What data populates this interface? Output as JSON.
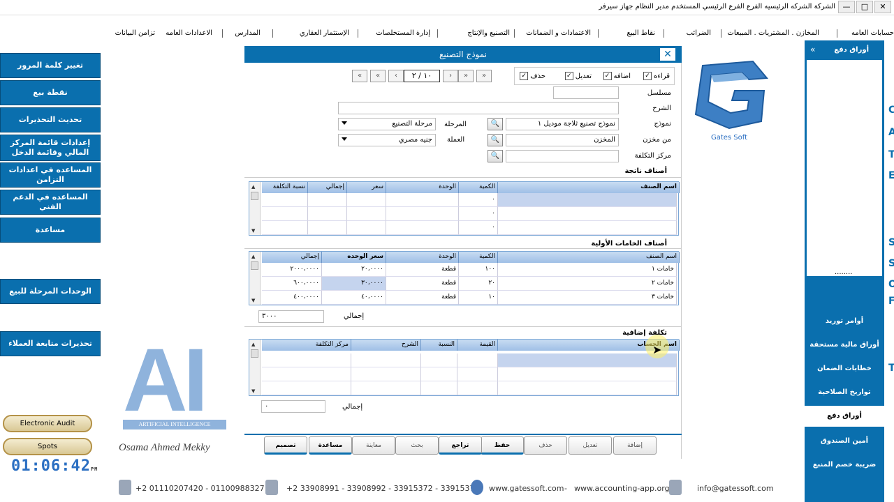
{
  "window": {
    "title": "الشركة الشركه الرئيسيه   الفرع الفرع الرئيسي   المستخدم مدير النظام   جهاز سيرفر",
    "buttons": [
      "—",
      "□",
      "✕"
    ]
  },
  "menu": [
    "حسابات العامه",
    "المخازن . المشتريات . المبيعات",
    "الضرائب",
    "نقاط البيع",
    "الاعتمادات و الضمانات",
    "التصنيع والإنتاج",
    "إدارة المستخلصات",
    "الإستثمار العقاري",
    "المدارس",
    "الاعدادات العامه",
    "تزامن البيانات"
  ],
  "left_buttons": [
    "تغيير كلمة المرور",
    "نقطة بيع",
    "تحديث التحذيرات",
    "إعدادات قائمة المركز المالي وقائمة الدخل",
    "المساعده في اعدادات التزامن",
    "المساعده في الدعم الفني",
    "مساعدة",
    "الوحدات المرحلة للبيع",
    "تحذيرات متابعة العملاء"
  ],
  "yellow_buttons": [
    "Electronic Audit",
    "Spots"
  ],
  "clock": {
    "time": "01:06:42",
    "suffix": "PM"
  },
  "right_panel": {
    "header": "أوراق دفع",
    "collapse_icon": "«",
    "dots": "........",
    "items": [
      "أوامر توريد",
      "أوراق مالية مستحقة",
      "خطابات الضمان",
      "تواريخ الصلاحية",
      "أوراق دفع",
      "أمين الصندوق",
      "ضريبة خصم المنبع"
    ],
    "active_index": 4
  },
  "right_strip_letters": [
    "C",
    "A",
    "T",
    "E",
    "S",
    "S",
    "O",
    "F",
    "T"
  ],
  "dialog": {
    "title": "نموذج التصنيع",
    "pager": "١٠ / ٢",
    "nav": [
      "«",
      "‹",
      "›",
      "»"
    ],
    "permissions": [
      {
        "label": "قراءه",
        "checked": true
      },
      {
        "label": "اضافه",
        "checked": true
      },
      {
        "label": "تعديل",
        "checked": true
      },
      {
        "label": "حذف",
        "checked": true
      }
    ],
    "fields": {
      "serial_label": "مسلسل",
      "serial_value": "",
      "desc_label": "الشرح",
      "desc_value": "",
      "model_label": "نموذج",
      "model_value": "نموذج تصنيع ثلاجة موديل ١",
      "stage_label": "المرحلة",
      "stage_value": "مرحلة التصنيع",
      "from_store_label": "من مخزن",
      "from_store_value": "المخزن",
      "currency_label": "العملة",
      "currency_value": "جنيه مصري",
      "cost_center_label": "مركز التكلفة",
      "cost_center_value": ""
    },
    "products_section": "أصناف ناتجة",
    "products_grid": {
      "headers": [
        "اسم الصنف",
        "الكمية",
        "الوحدة",
        "سعر",
        "إجمالي",
        "نسبة التكلفة"
      ],
      "rows": [
        [
          "",
          "٠",
          "",
          "",
          "",
          ""
        ],
        [
          "",
          "٠",
          "",
          "",
          "",
          ""
        ],
        [
          "",
          "٠",
          "",
          "",
          "",
          ""
        ]
      ]
    },
    "materials_section": "أصناف الخامات الأولية",
    "materials_grid": {
      "headers": [
        "اسم الصنف",
        "الكمية",
        "الوحدة",
        "سعر الوحده",
        "إجمالي"
      ],
      "rows": [
        [
          "خامات ١",
          "١٠٠",
          "قطعة",
          "٢٠،٠٠٠٠",
          "٢٠٠٠،٠٠٠٠"
        ],
        [
          "خامات ٢",
          "٢٠",
          "قطعة",
          "٣٠،٠٠٠٠",
          "٦٠٠،٠٠٠٠"
        ],
        [
          "خامات ٣",
          "١٠",
          "قطعة",
          "٤٠،٠٠٠٠",
          "٤٠٠،٠٠٠٠"
        ]
      ]
    },
    "materials_total_label": "إجمالي",
    "materials_total_value": "٣٠٠٠",
    "extra_section": "تكلفة إضافية",
    "extra_grid": {
      "headers": [
        "اسم الحساب",
        "القيمة",
        "النسبة",
        "الشرح",
        "مركز التكلفة"
      ],
      "rows": [
        [
          "",
          "",
          "",
          "",
          ""
        ],
        [
          "",
          "",
          "",
          "",
          ""
        ],
        [
          "",
          "",
          "",
          "",
          ""
        ]
      ]
    },
    "extra_total_label": "إجمالي",
    "extra_total_value": "٠",
    "toolbar": [
      "إضافة",
      "تعديل",
      "حذف",
      "حفظ",
      "تراجع",
      "بحث",
      "معاينة",
      "مساعدة",
      "تصميم"
    ]
  },
  "gates_logo": {
    "text": "Gates Soft"
  },
  "ai_logo": {
    "letters": "AI",
    "caption": "ARTIFICIAL INTELLIGENCE",
    "signature": "Osama Ahmed Mekky"
  },
  "footer": {
    "phone": "+2 01110207420 - 01100988327",
    "landline": "+2 33908991 - 33908992 - 33915372 - 33915373",
    "website": "www.gatessoft.com",
    "dash": "-",
    "website2": "www.accounting-app.org",
    "email": "info@gatessoft.com"
  },
  "colors": {
    "primary": "#0a6fae",
    "grid_header": "#9fbfe6",
    "selected": "#c5d4ee"
  }
}
